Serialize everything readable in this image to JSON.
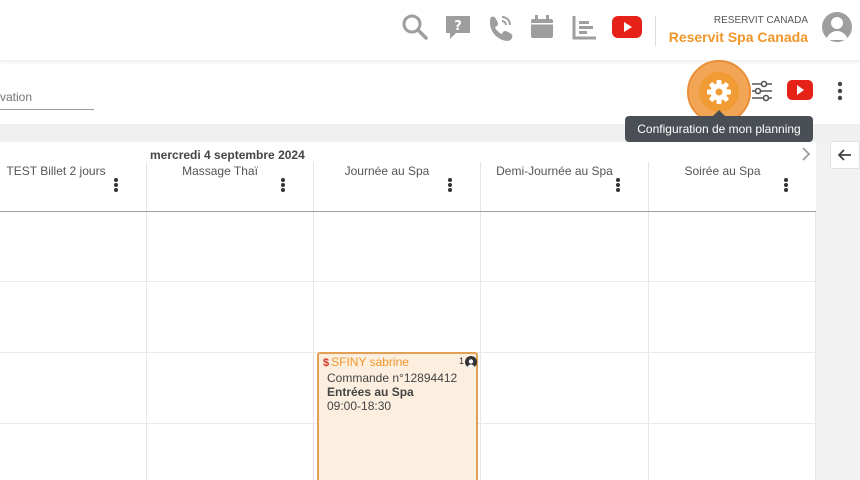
{
  "header": {
    "org_small": "RESERVIT CANADA",
    "org_name": "Reservit Spa Canada",
    "icons": [
      "search-icon",
      "help-icon",
      "phone-icon",
      "calendar-icon",
      "stats-icon",
      "youtube-icon"
    ]
  },
  "toolbar": {
    "search_placeholder": "vation",
    "tooltip": "Configuration de mon planning",
    "icons": [
      "gear-icon",
      "sliders-icon",
      "youtube-icon",
      "more-vertical-icon"
    ]
  },
  "planning": {
    "date": "mercredi 4 septembre 2024",
    "columns": [
      "TEST Billet 2 jours",
      "Massage Thaï",
      "Journée au Spa",
      "Demi-Journée au Spa",
      "Soirée au Spa"
    ]
  },
  "reservation": {
    "currency": "$",
    "name": "SFINY sabrine",
    "guests": "1",
    "order": "Commande n°12894412",
    "product": "Entrées au Spa",
    "time": "09:00-18:30"
  },
  "colors": {
    "accent": "#f0962a",
    "youtube": "#e62117",
    "card_bg": "#fcefdf",
    "tooltip_bg": "#4a4f55"
  }
}
